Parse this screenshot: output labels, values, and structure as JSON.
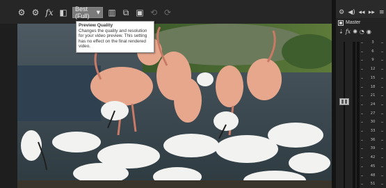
{
  "preview_toolbar": {
    "buttons": [
      "gear-icon",
      "mixer-settings-icon",
      "fx-icon",
      "split-screen-icon"
    ],
    "quality_select": {
      "value": "Best (Full)"
    },
    "right_buttons": [
      "overlays-icon",
      "copy-snapshot-icon",
      "save-snapshot-icon",
      "undo-icon",
      "redo-icon"
    ]
  },
  "tooltip": {
    "title": "Preview Quality",
    "body": "Changes the quality and resolution for your video preview. This setting has no effect on the final rendered video."
  },
  "mixer": {
    "toolbar_icons": [
      "gear-icon",
      "speaker-icon",
      "previous-icon",
      "next-icon",
      "menu-icon"
    ],
    "channel": {
      "label": "Master",
      "icons": [
        "insert-icon",
        "fx-icon",
        "gear-icon",
        "automation-icon",
        "record-icon"
      ]
    },
    "scale": [
      "3",
      "6",
      "9",
      "12",
      "15",
      "18",
      "21",
      "24",
      "27",
      "30",
      "33",
      "36",
      "39",
      "42",
      "45",
      "48",
      "51"
    ]
  }
}
